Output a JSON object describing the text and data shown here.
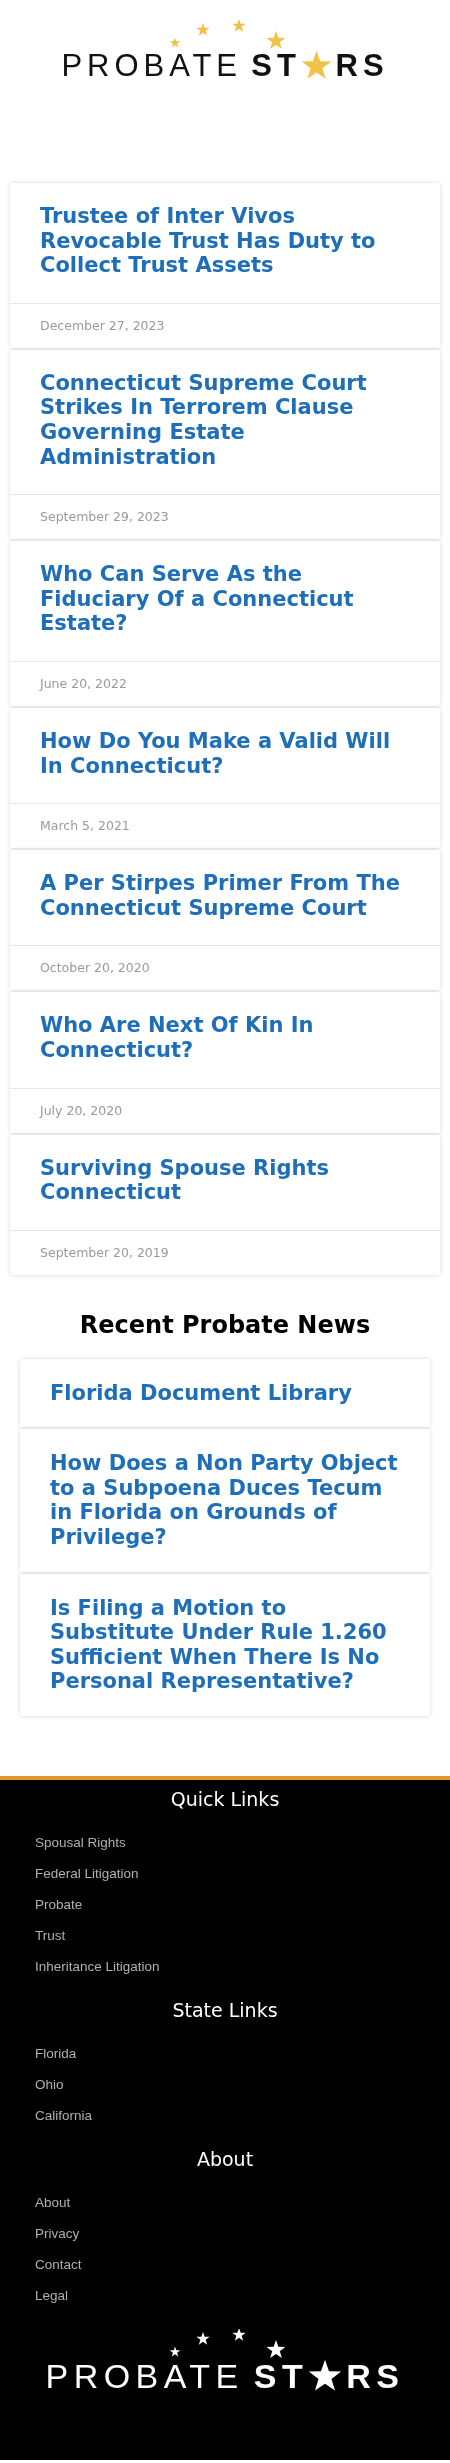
{
  "header": {
    "logo": {
      "first_word": "PROBATE",
      "second_word_start": "ST",
      "second_word_end": "RS"
    }
  },
  "posts": [
    {
      "title": "Trustee of Inter Vivos Revocable Trust Has Duty to Collect Trust Assets",
      "date": "December 27, 2023"
    },
    {
      "title": "Connecticut Supreme Court Strikes In Terrorem Clause Governing Estate Administration",
      "date": "September 29, 2023"
    },
    {
      "title": "Who Can Serve As the Fiduciary Of a Connecticut Estate?",
      "date": "June 20, 2022"
    },
    {
      "title": "How Do You Make a Valid Will In Connecticut?",
      "date": "March 5, 2021"
    },
    {
      "title": "A Per Stirpes Primer From The Connecticut Supreme Court",
      "date": "October 20, 2020"
    },
    {
      "title": "Who Are Next Of Kin In Connecticut?",
      "date": "July 20, 2020"
    },
    {
      "title": "Surviving Spouse Rights Connecticut",
      "date": "September 20, 2019"
    }
  ],
  "recent_news": {
    "heading": "Recent Probate News",
    "items": [
      {
        "title": "Florida Document Library"
      },
      {
        "title": "How Does a Non Party Object to a Subpoena Duces Tecum in Florida on Grounds of Privilege?"
      },
      {
        "title": "Is Filing a Motion to Substitute Under Rule 1.260 Sufficient When There Is No Personal Representative?"
      }
    ]
  },
  "footer": {
    "sections": [
      {
        "heading": "Quick Links",
        "links": [
          "Spousal Rights",
          "Federal Litigation",
          "Probate",
          "Trust",
          "Inheritance Litigation"
        ]
      },
      {
        "heading": "State Links",
        "links": [
          "Florida",
          "Ohio",
          "California"
        ]
      },
      {
        "heading": "About",
        "links": [
          "About",
          "Privacy",
          "Contact",
          "Legal"
        ]
      }
    ],
    "logo": {
      "first_word": "PROBATE",
      "second_word_start": "ST",
      "second_word_end": "RS"
    }
  }
}
